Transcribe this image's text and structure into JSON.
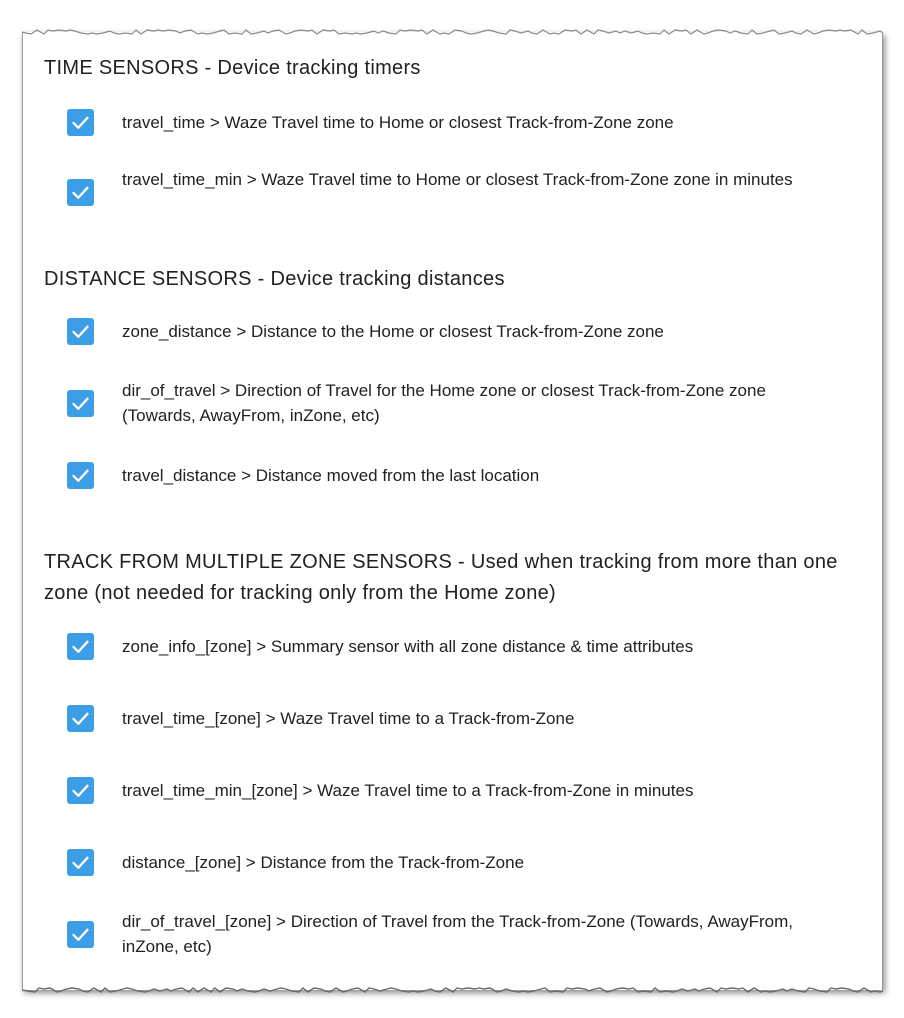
{
  "accent_color": "#3d9ee8",
  "sections": [
    {
      "title": "TIME SENSORS - Device tracking timers",
      "items": [
        {
          "label": "travel_time > Waze Travel time to Home or closest Track-from-Zone zone",
          "checked": true
        },
        {
          "label": "travel_time_min > Waze Travel time to Home or closest Track-from-Zone zone in minutes",
          "checked": true
        }
      ]
    },
    {
      "title": "DISTANCE SENSORS - Device tracking distances",
      "items": [
        {
          "label": "zone_distance > Distance to the Home or closest Track-from-Zone zone",
          "checked": true
        },
        {
          "label": "dir_of_travel > Direction of Travel for the Home zone or closest Track-from-Zone zone (Towards, AwayFrom, inZone, etc)",
          "checked": true
        },
        {
          "label": "travel_distance > Distance moved from the last location",
          "checked": true
        }
      ]
    },
    {
      "title": "TRACK FROM MULTIPLE ZONE SENSORS - Used when tracking from more than one zone (not needed for tracking only from the Home zone)",
      "items": [
        {
          "label": "zone_info_[zone] > Summary sensor with all zone distance & time attributes",
          "checked": true
        },
        {
          "label": "travel_time_[zone] > Waze Travel time to a Track-from-Zone",
          "checked": true
        },
        {
          "label": "travel_time_min_[zone] > Waze Travel time to a Track-from-Zone in minutes",
          "checked": true
        },
        {
          "label": "distance_[zone] > Distance from the Track-from-Zone",
          "checked": true
        },
        {
          "label": "dir_of_travel_[zone] > Direction of Travel from the Track-from-Zone (Towards, AwayFrom, inZone, etc)",
          "checked": true
        }
      ]
    }
  ]
}
